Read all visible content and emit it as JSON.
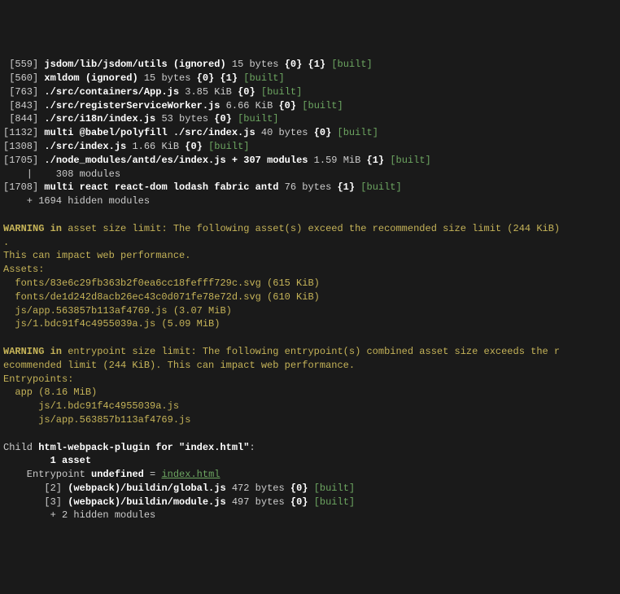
{
  "modules": [
    {
      "id": "559",
      "name": "jsdom/lib/jsdom/utils (ignored)",
      "size": "15 bytes",
      "chunks": "{0} {1}",
      "status": "[built]"
    },
    {
      "id": "560",
      "name": "xmldom (ignored)",
      "size": "15 bytes",
      "chunks": "{0} {1}",
      "status": "[built]"
    },
    {
      "id": "763",
      "name": "./src/containers/App.js",
      "size": "3.85 KiB",
      "chunks": "{0}",
      "status": "[built]"
    },
    {
      "id": "843",
      "name": "./src/registerServiceWorker.js",
      "size": "6.66 KiB",
      "chunks": "{0}",
      "status": "[built]"
    },
    {
      "id": "844",
      "name": "./src/i18n/index.js",
      "size": "53 bytes",
      "chunks": "{0}",
      "status": "[built]"
    },
    {
      "id": "1132",
      "name": "multi @babel/polyfill ./src/index.js",
      "size": "40 bytes",
      "chunks": "{0}",
      "status": "[built]"
    },
    {
      "id": "1308",
      "name": "./src/index.js",
      "size": "1.66 KiB",
      "chunks": "{0}",
      "status": "[built]"
    },
    {
      "id": "1705",
      "name": "./node_modules/antd/es/index.js + 307 modules",
      "size": "1.59 MiB",
      "chunks": "{1}",
      "status": "[built]"
    }
  ],
  "subModuleLine": "    |    308 modules",
  "module1708": {
    "id": "1708",
    "name": "multi react react-dom lodash fabric antd",
    "size": "76 bytes",
    "chunks": "{1}",
    "status": "[built]"
  },
  "hiddenModulesLine": "    + 1694 hidden modules",
  "warningAsset": {
    "kw": "WARNING in ",
    "title1": "asset size limit: The following asset(s) exceed the recommended size limit (244 KiB)",
    "dot": ".",
    "line2": "This can impact web performance.",
    "assetsLabel": "Assets:",
    "items": [
      "  fonts/83e6c29fb363b2f0ea6cc18fefff729c.svg (615 KiB)",
      "  fonts/de1d242d8acb26ec43c0d071fe78e72d.svg (610 KiB)",
      "  js/app.563857b113af4769.js (3.07 MiB)",
      "  js/1.bdc91f4c4955039a.js (5.09 MiB)"
    ]
  },
  "warningEntry": {
    "kw": "WARNING in ",
    "title": "entrypoint size limit: The following entrypoint(s) combined asset size exceeds the r\necommended limit (244 KiB). This can impact web performance.",
    "entryLabel": "Entrypoints:",
    "appLine": "  app (8.16 MiB)",
    "items": [
      "      js/1.bdc91f4c4955039a.js",
      "      js/app.563857b113af4769.js"
    ]
  },
  "child": {
    "prefix": "Child ",
    "pluginBold": "html-webpack-plugin for \"index.html\"",
    "colon": ":",
    "oneAsset": "        1 asset",
    "entryPrefix": "    Entrypoint ",
    "undefined": "undefined",
    "equals": " = ",
    "indexhtml": "index.html",
    "modules": [
      {
        "id": "2",
        "name": "(webpack)/buildin/global.js",
        "size": "472 bytes",
        "chunks": "{0}",
        "status": "[built]"
      },
      {
        "id": "3",
        "name": "(webpack)/buildin/module.js",
        "size": "497 bytes",
        "chunks": "{0}",
        "status": "[built]"
      }
    ],
    "hidden": "        + 2 hidden modules"
  }
}
